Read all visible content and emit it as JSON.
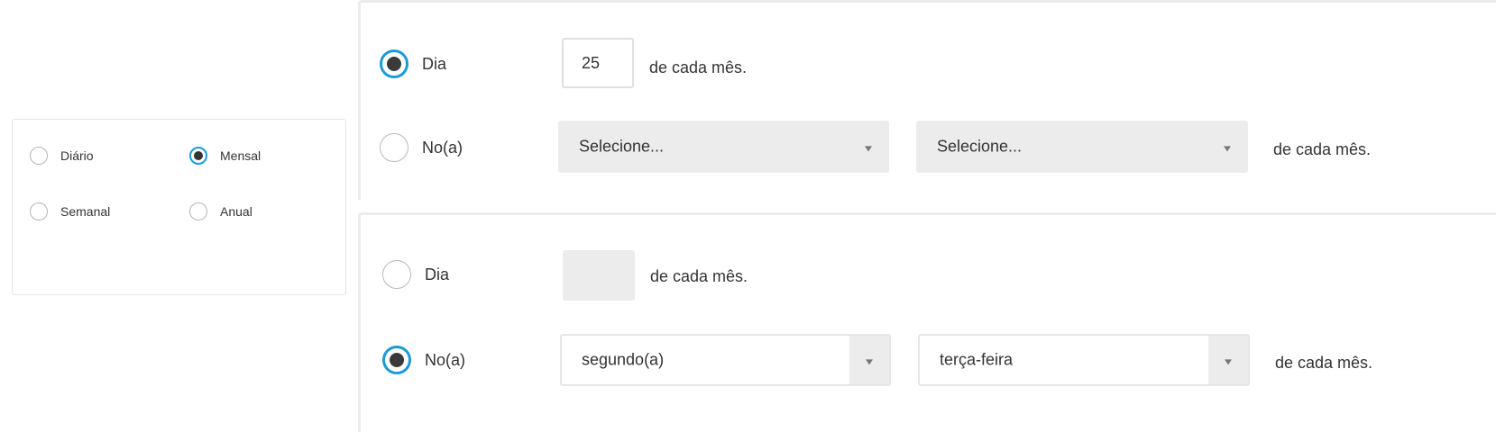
{
  "frequency": {
    "options": [
      {
        "label": "Diário",
        "checked": false
      },
      {
        "label": "Mensal",
        "checked": true
      },
      {
        "label": "Semanal",
        "checked": false
      },
      {
        "label": "Anual",
        "checked": false
      }
    ]
  },
  "panel1": {
    "day_option": {
      "label": "Dia",
      "checked": true
    },
    "day_value": "25",
    "day_suffix": "de cada mês.",
    "on_option": {
      "label": "No(a)",
      "checked": false
    },
    "select_ordinal": {
      "value": "Selecione...",
      "disabled": true
    },
    "select_weekday": {
      "value": "Selecione...",
      "disabled": true
    },
    "on_suffix": "de cada mês."
  },
  "panel2": {
    "day_option": {
      "label": "Dia",
      "checked": false
    },
    "day_value": "",
    "day_suffix": "de cada mês.",
    "on_option": {
      "label": "No(a)",
      "checked": true
    },
    "select_ordinal": {
      "value": "segundo(a)",
      "disabled": false
    },
    "select_weekday": {
      "value": "terça-feira",
      "disabled": false
    },
    "on_suffix": "de cada mês."
  },
  "colors": {
    "accent": "#1a9bd7",
    "disabled_bg": "#ececec",
    "text": "#333333"
  },
  "icons": {
    "dropdown": "chevron-down-icon",
    "radio": "radio-button"
  }
}
